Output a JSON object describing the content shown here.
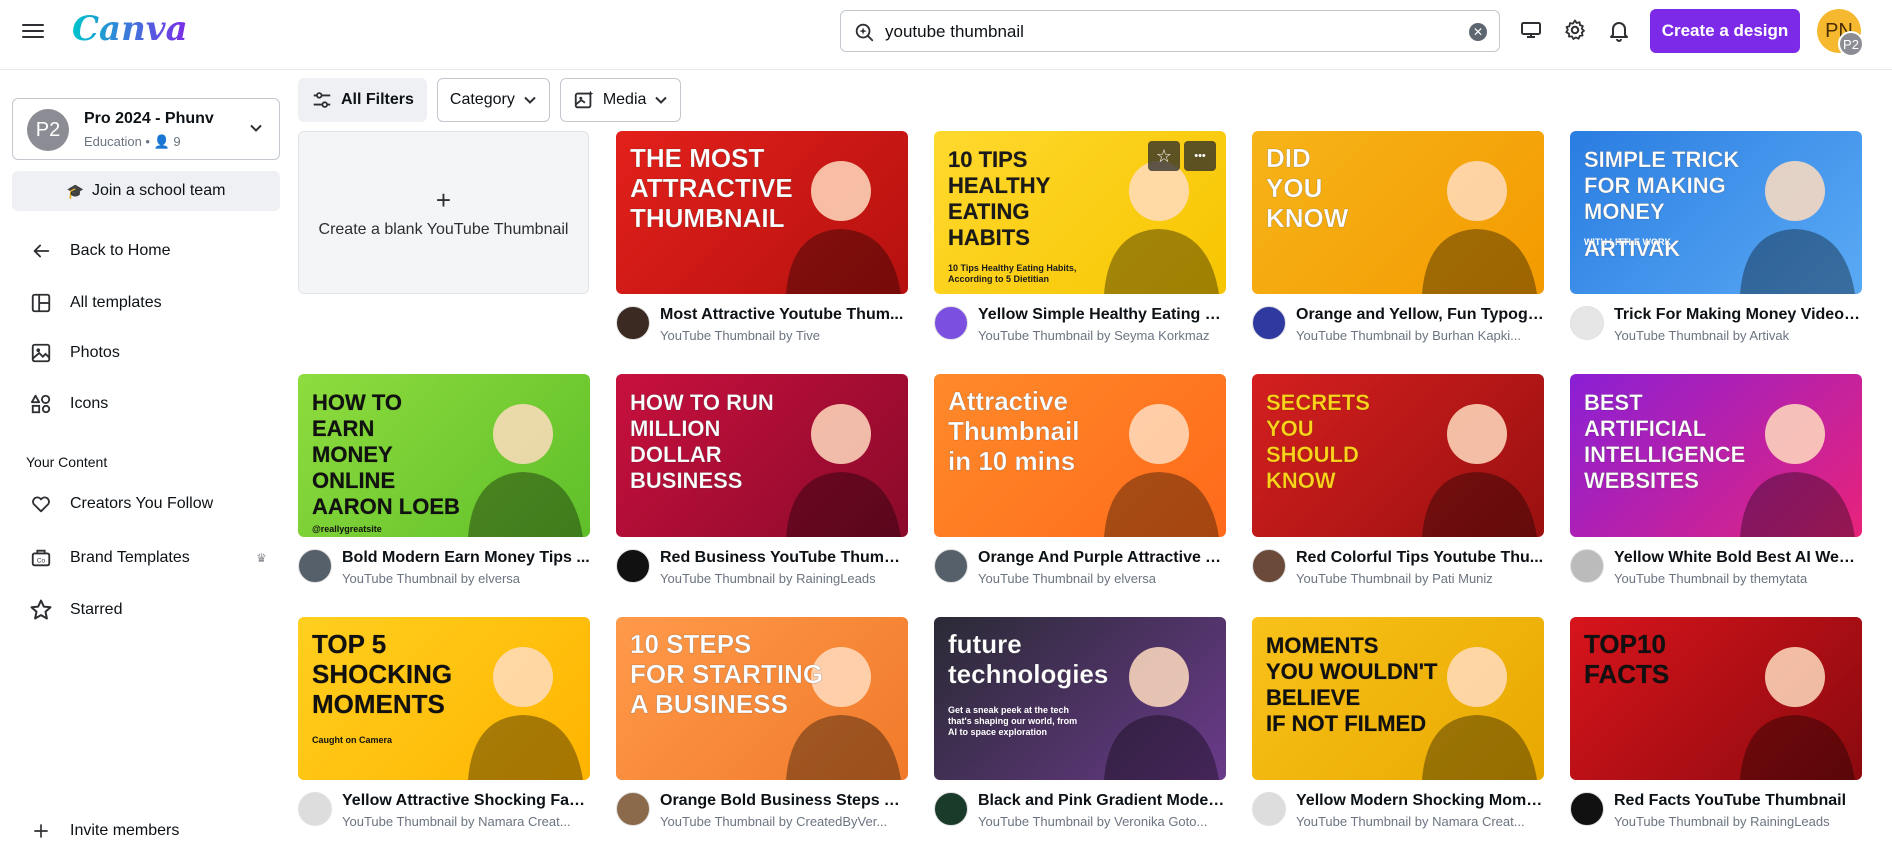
{
  "header": {
    "logo": "Canva",
    "search_value": "youtube thumbnail",
    "create_label": "Create a design",
    "avatar_initials": "PN",
    "avatar_badge": "P2"
  },
  "sidebar": {
    "team": {
      "avatar": "P2",
      "name": "Pro 2024 - Phunv",
      "subtitle": "Education • 👤 9"
    },
    "school_button": "Join a school team",
    "nav": [
      {
        "label": "Back to Home",
        "icon": "back-arrow-icon"
      },
      {
        "label": "All templates",
        "icon": "templates-icon"
      },
      {
        "label": "Photos",
        "icon": "photo-icon"
      },
      {
        "label": "Icons",
        "icon": "shapes-icon"
      }
    ],
    "your_content_title": "Your Content",
    "content": [
      {
        "label": "Creators You Follow",
        "icon": "heart-icon"
      },
      {
        "label": "Brand Templates",
        "icon": "brand-templates-icon"
      },
      {
        "label": "Starred",
        "icon": "star-icon"
      }
    ],
    "invite": "Invite members"
  },
  "filters": {
    "all": "All Filters",
    "category": "Category",
    "media": "Media"
  },
  "blank_card": {
    "label": "Create a blank YouTube Thumbnail"
  },
  "cards": [
    {
      "title": "Most Attractive Youtube Thum...",
      "sub": "YouTube Thumbnail by Tive",
      "lines": [
        "THE MOST",
        "ATTRACTIVE",
        "THUMBNAIL"
      ],
      "bg": "#e3201b",
      "bg2": "#b5110f",
      "fg": "#ffffff",
      "av": "#3a2a22"
    },
    {
      "title": "Yellow Simple Healthy Eating H...",
      "sub": "YouTube Thumbnail by Seyma Korkmaz",
      "lines": [
        "10 TIPS",
        "HEALTHY",
        "EATING",
        "HABITS",
        "10 Tips Healthy Eating Habits,",
        "According to 5 Dietitian"
      ],
      "bg": "#ffd92e",
      "bg2": "#f7c500",
      "fg": "#1a1a1a",
      "av": "#7b4fe0"
    },
    {
      "title": "Orange and Yellow, Fun Typogr...",
      "sub": "YouTube Thumbnail by Burhan Kapki...",
      "lines": [
        "DID",
        "YOU",
        "KNOW"
      ],
      "bg": "#f6b419",
      "bg2": "#f39a00",
      "fg": "#ffffff",
      "av": "#2f3aa0"
    },
    {
      "title": "Trick For Making Money Video Y...",
      "sub": "YouTube Thumbnail by Artivak",
      "lines": [
        "SIMPLE TRICK",
        "FOR MAKING",
        "MONEY",
        "WITH LITTLE WORK",
        "ARTIVAK"
      ],
      "bg": "#2a7de1",
      "bg2": "#5aaaf5",
      "fg": "#ffffff",
      "av": "#e6e6e6"
    },
    {
      "title": "Bold Modern Earn Money Tips ...",
      "sub": "YouTube Thumbnail by elversa",
      "lines": [
        "HOW TO",
        "EARN",
        "MONEY",
        "ONLINE",
        "AARON LOEB",
        "@reallygreatsite"
      ],
      "bg": "#8edc3e",
      "bg2": "#5fbf2a",
      "fg": "#111111",
      "av": "#56606a"
    },
    {
      "title": "Red Business YouTube Thumbn...",
      "sub": "YouTube Thumbnail by RainingLeads",
      "lines": [
        "HOW TO RUN",
        "MILLION",
        "DOLLAR",
        "BUSINESS"
      ],
      "bg": "#c8103e",
      "bg2": "#8a0a2a",
      "fg": "#ffffff",
      "av": "#111111"
    },
    {
      "title": "Orange And Purple Attractive Y...",
      "sub": "YouTube Thumbnail by elversa",
      "lines": [
        "Attractive",
        "Thumbnail",
        "in 10 mins"
      ],
      "bg": "#ff8a2a",
      "bg2": "#ff6a1a",
      "fg": "#ffffff",
      "av": "#56606a"
    },
    {
      "title": "Red Colorful Tips Youtube Thu...",
      "sub": "YouTube Thumbnail by Pati Muniz",
      "lines": [
        "SECRETS",
        "YOU",
        "SHOULD",
        "KNOW"
      ],
      "bg": "#d41f1f",
      "bg2": "#9a1010",
      "fg": "#ffd21c",
      "av": "#6b4a3a"
    },
    {
      "title": "Yellow White Bold Best AI Webs...",
      "sub": "YouTube Thumbnail by themytata",
      "lines": [
        "BEST",
        "ARTIFICIAL",
        "INTELLIGENCE",
        "WEBSITES"
      ],
      "bg": "#8a1fd6",
      "bg2": "#e8237a",
      "fg": "#ffffff",
      "av": "#bbbbbb"
    },
    {
      "title": "Yellow Attractive Shocking Fact...",
      "sub": "YouTube Thumbnail by Namara Creat...",
      "lines": [
        "TOP 5",
        "SHOCKING",
        "MOMENTS",
        "Caught on Camera"
      ],
      "bg": "#ffcf1f",
      "bg2": "#ffb400",
      "fg": "#111111",
      "av": "#dddddd"
    },
    {
      "title": "Orange Bold Business Steps Yo...",
      "sub": "YouTube Thumbnail by CreatedByVer...",
      "lines": [
        "10 STEPS",
        "FOR STARTING",
        "A BUSINESS"
      ],
      "bg": "#ff9a4a",
      "bg2": "#f07a2a",
      "fg": "#ffffff",
      "av": "#8a6a4a"
    },
    {
      "title": "Black and Pink Gradient Moder...",
      "sub": "YouTube Thumbnail by Veronika Goto...",
      "lines": [
        "future",
        "technologies",
        "Get a sneak peek at the tech",
        "that's shaping our world, from",
        "AI to space exploration"
      ],
      "bg": "#2a2a35",
      "bg2": "#6a3a8a",
      "fg": "#ffffff",
      "av": "#1a3a2a"
    },
    {
      "title": "Yellow Modern Shocking Mome...",
      "sub": "YouTube Thumbnail by Namara Creat...",
      "lines": [
        "MOMENTS",
        "YOU WOULDN'T",
        "BELIEVE",
        "IF NOT FILMED"
      ],
      "bg": "#f8c21a",
      "bg2": "#e8a800",
      "fg": "#111111",
      "av": "#dddddd"
    },
    {
      "title": "Red Facts YouTube Thumbnail",
      "sub": "YouTube Thumbnail by RainingLeads",
      "lines": [
        "TOP10",
        "FACTS"
      ],
      "bg": "#d8141c",
      "bg2": "#8a0a0e",
      "fg": "#111111",
      "av": "#111111"
    }
  ]
}
